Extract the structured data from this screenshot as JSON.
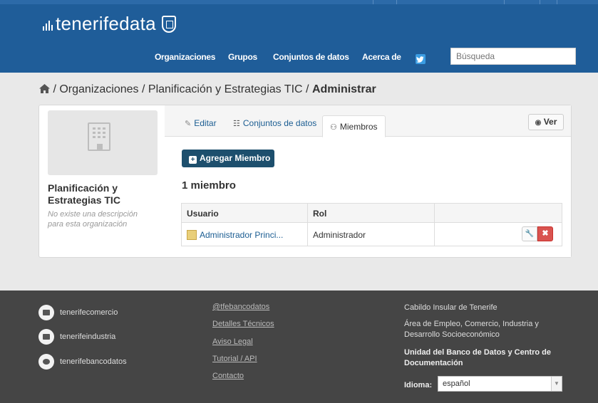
{
  "header": {
    "logo_text": "tenerifedata",
    "nav": [
      {
        "label": "Organizaciones"
      },
      {
        "label": "Grupos"
      },
      {
        "label": "Conjuntos de datos"
      },
      {
        "label": "Acerca de"
      }
    ],
    "search_placeholder": "Búsqueda",
    "colors": {
      "masthead": "#1f5d99",
      "twitter": "#3b9de3"
    }
  },
  "breadcrumb": {
    "items": [
      "Organizaciones",
      "Planificación y Estrategias TIC"
    ],
    "current": "Administrar",
    "separator": "/"
  },
  "organization": {
    "title": "Planificación y Estrategias TIC",
    "description": "No existe una descripción para esta organización"
  },
  "tabs": [
    {
      "label": "Editar",
      "icon": "edit-icon"
    },
    {
      "label": "Conjuntos de datos",
      "icon": "sitemap-icon"
    },
    {
      "label": "Miembros",
      "icon": "group-icon",
      "active": true
    }
  ],
  "view_button": "Ver",
  "add_member_button": "Agregar Miembro",
  "member_count": "1 miembro",
  "table": {
    "headers": [
      "Usuario",
      "Rol"
    ],
    "rows": [
      {
        "user": "Administrador Princi...",
        "role": "Administrador"
      }
    ]
  },
  "footer": {
    "social": [
      "tenerifecomercio",
      "tenerifeindustria",
      "tenerifebancodatos"
    ],
    "links": [
      "@tfebancodatos",
      "Detalles Técnicos",
      "Aviso Legal",
      "Tutorial / API",
      "Contacto"
    ],
    "info": {
      "cabildo": "Cabildo Insular de Tenerife",
      "area": "Área de Empleo, Comercio, Industria y Desarrollo Socioeconómico",
      "unidad": "Unidad del Banco de Datos y Centro de Documentación"
    },
    "language_label": "Idioma:",
    "language_value": "español"
  }
}
